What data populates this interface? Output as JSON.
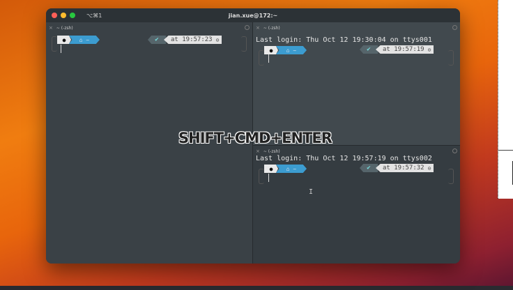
{
  "window": {
    "title": "jian.xue@172:~",
    "shortcut": "⌥⌘1",
    "traffic_colors": [
      "#fe5f57",
      "#febc2e",
      "#28c840"
    ]
  },
  "panes": [
    {
      "tab": "~ (-zsh)",
      "login": "",
      "time": "at 19:57:23",
      "home": "⌂ ~",
      "apple": "",
      "ok": "✔",
      "clock": "⊙"
    },
    {
      "tab": "~ (-zsh)",
      "login": "Last login: Thu Oct 12 19:30:04 on ttys001",
      "time": "at 19:57:19",
      "home": "⌂ ~",
      "apple": "",
      "ok": "✔",
      "clock": "⊙"
    },
    {
      "tab": "~ (-zsh)",
      "login": "Last login: Thu Oct 12 19:57:19 on ttys002",
      "time": "at 19:57:32",
      "home": "⌂ ~",
      "apple": "",
      "ok": "✔",
      "clock": "⊙"
    }
  ],
  "overlay": "SHIFT+CMD+ENTER",
  "icons": {
    "close": "×",
    "ibeam": "I"
  }
}
